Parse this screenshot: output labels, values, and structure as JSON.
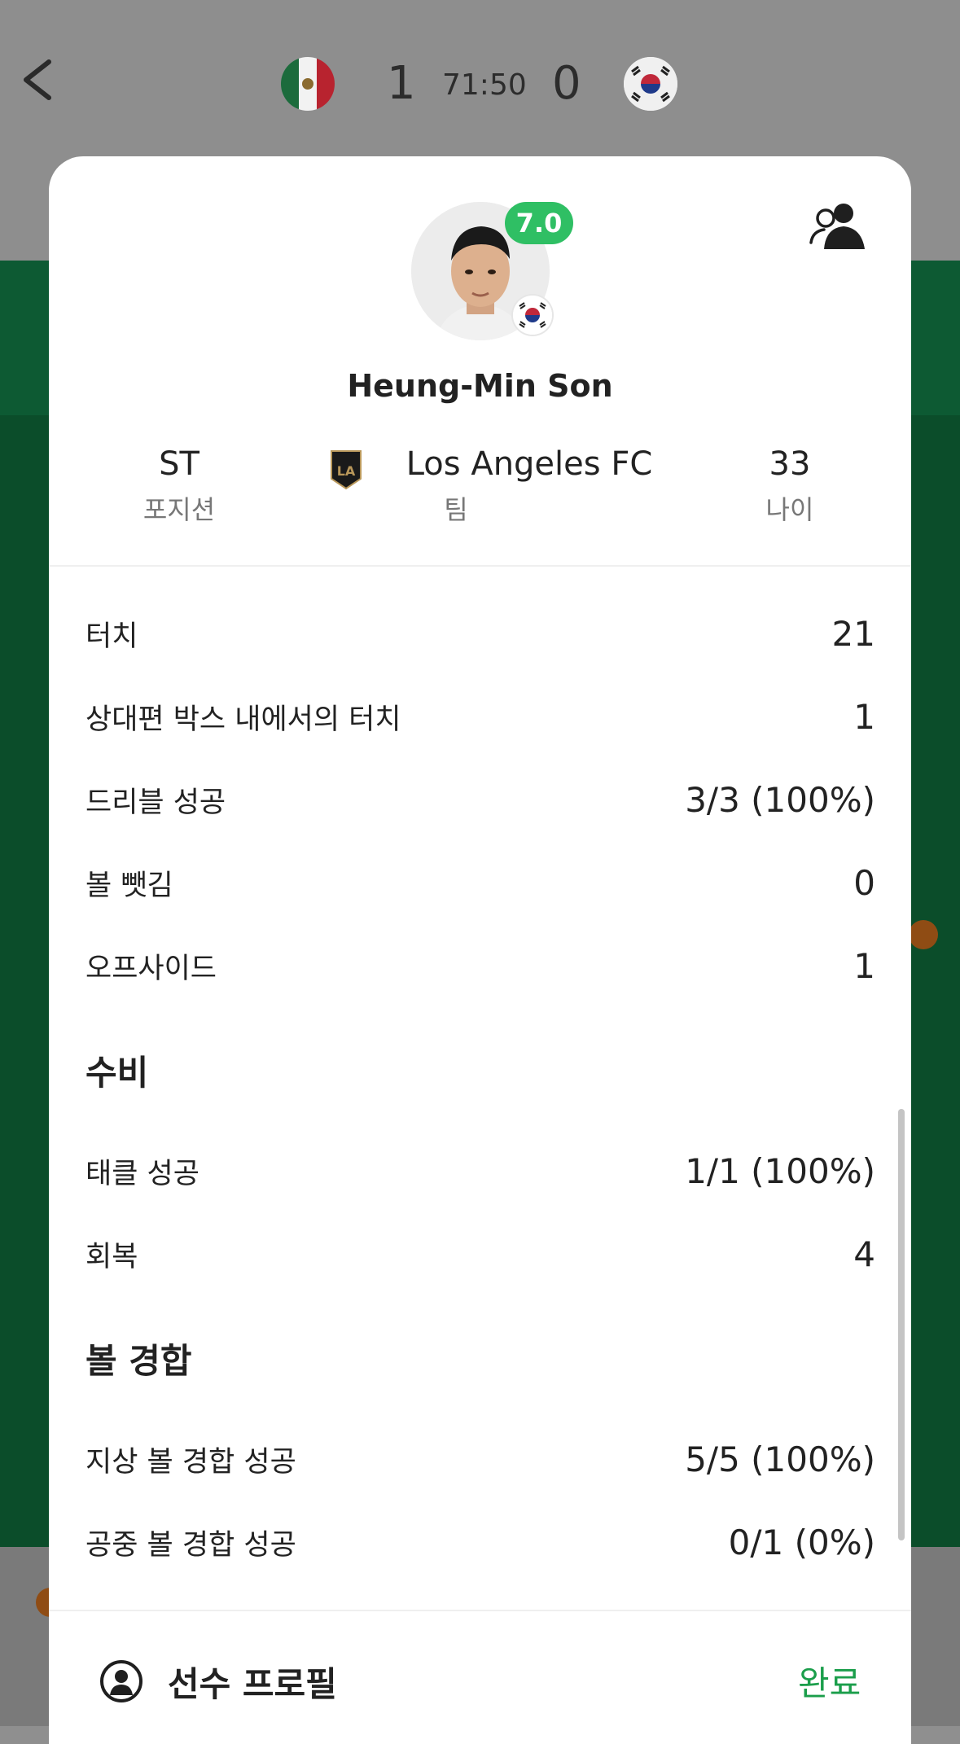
{
  "header": {
    "home_score": "1",
    "time": "71:50",
    "away_score": "0",
    "home_flag": "mexico-flag-icon",
    "away_flag": "south-korea-flag-icon"
  },
  "player": {
    "rating": "7.0",
    "rating_color": "#2fbf64",
    "name": "Heung-Min Son",
    "position_value": "ST",
    "position_label": "포지션",
    "team_value": "Los Angeles FC",
    "team_label": "팀",
    "age_value": "33",
    "age_label": "나이"
  },
  "stats": [
    {
      "label": "터치",
      "value": "21"
    },
    {
      "label": "상대편 박스 내에서의 터치",
      "value": "1"
    },
    {
      "label": "드리블 성공",
      "value": "3/3 (100%)"
    },
    {
      "label": "볼 뺏김",
      "value": "0"
    },
    {
      "label": "오프사이드",
      "value": "1"
    }
  ],
  "sections": {
    "defense": {
      "title": "수비",
      "rows": [
        {
          "label": "태클 성공",
          "value": "1/1 (100%)"
        },
        {
          "label": "회복",
          "value": "4"
        }
      ]
    },
    "duels": {
      "title": "볼 경합",
      "rows": [
        {
          "label": "지상 볼 경합 성공",
          "value": "5/5 (100%)"
        },
        {
          "label": "공중 볼 경합 성공",
          "value": "0/1 (0%)"
        }
      ]
    }
  },
  "footer": {
    "profile_label": "선수 프로필",
    "done_label": "완료",
    "done_color": "#1b9e4b"
  }
}
